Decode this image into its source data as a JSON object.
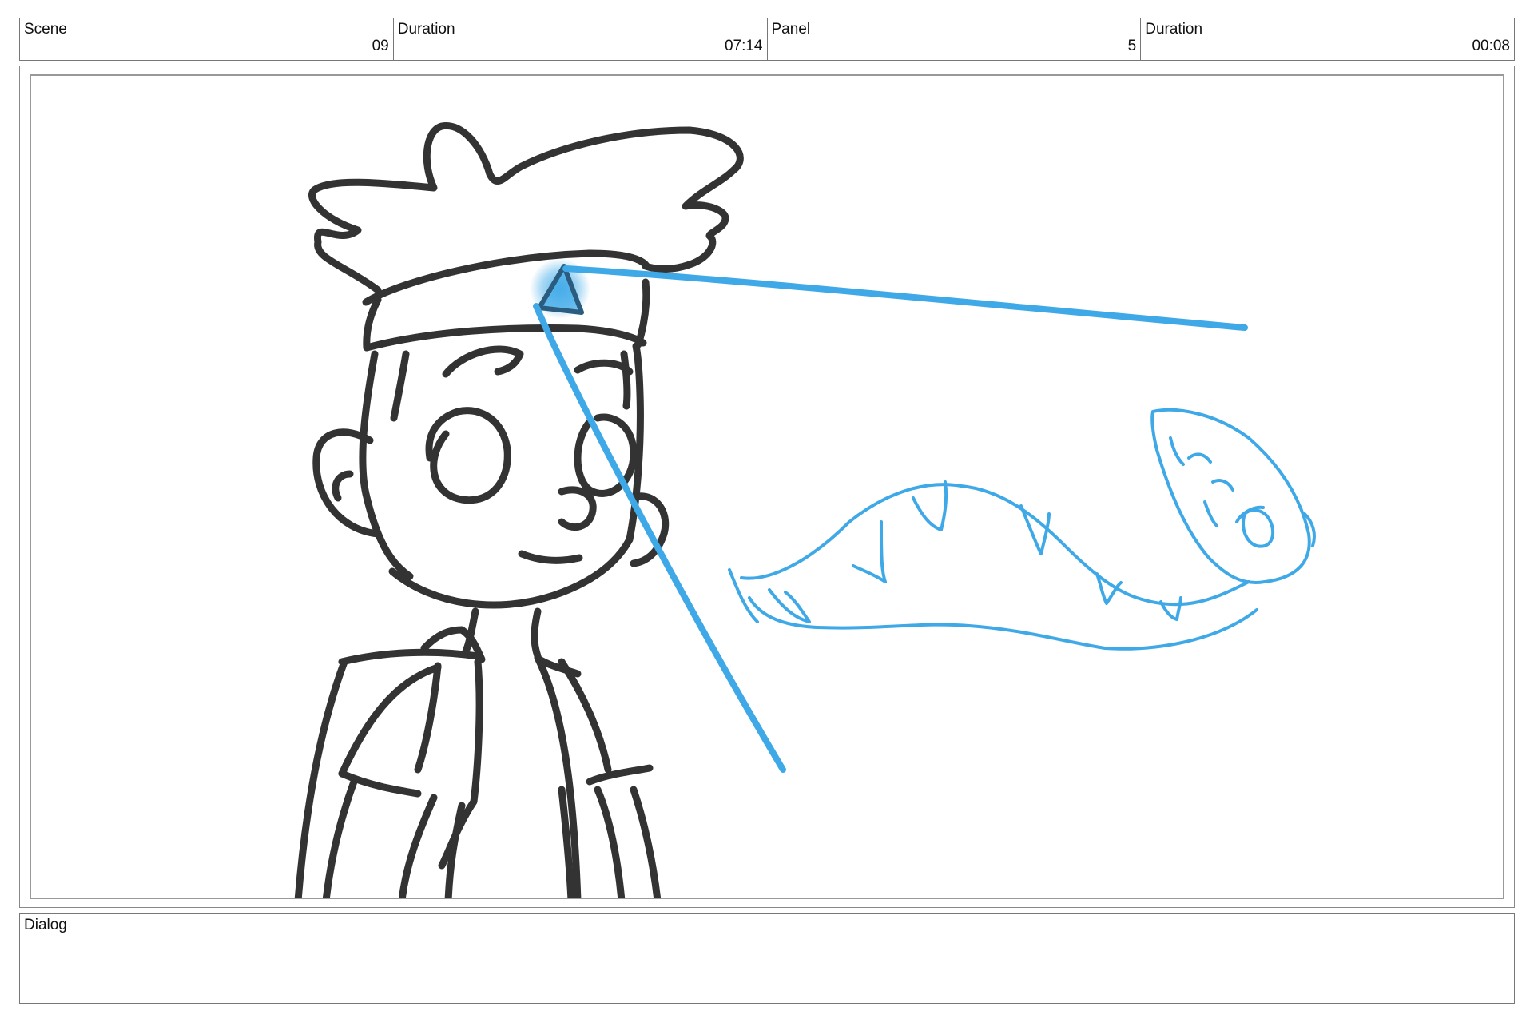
{
  "header": {
    "cells": [
      {
        "label": "Scene",
        "value": "09"
      },
      {
        "label": "Duration",
        "value": "07:14"
      },
      {
        "label": "Panel",
        "value": "5"
      },
      {
        "label": "Duration",
        "value": "00:08"
      }
    ]
  },
  "dialog": {
    "label": "Dialog"
  },
  "colors": {
    "ink": "#333333",
    "sketch": "#3fa9e8"
  }
}
